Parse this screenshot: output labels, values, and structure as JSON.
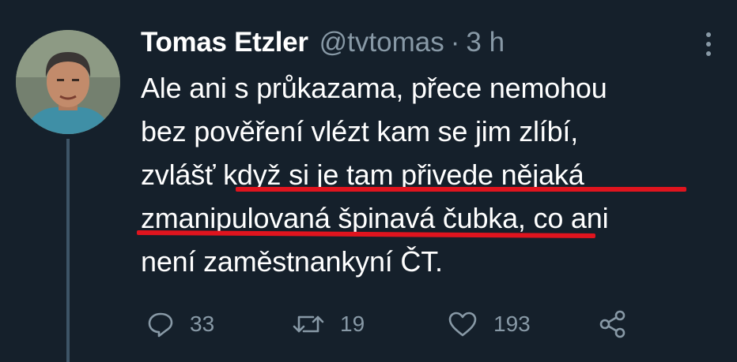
{
  "tweet": {
    "display_name": "Tomas Etzler",
    "handle": "@tvtomas",
    "separator": "·",
    "time": "3 h",
    "text_lines": [
      "Ale ani s průkazama, přece nemohou",
      "bez pověření vlézt kam se jim zlíbí,",
      "zvlášť když si je tam přivede nějaká",
      "zmanipulovaná špinavá čubka, co ani",
      "není zaměstnankyní ČT."
    ],
    "replies": "33",
    "retweets": "19",
    "likes": "193"
  },
  "colors": {
    "background": "#15202b",
    "secondary_text": "#8899a6",
    "underline_red": "#e0141e",
    "thread_line": "#3d5466"
  },
  "icons": {
    "more": "more-vertical-icon",
    "reply": "reply-icon",
    "retweet": "retweet-icon",
    "like": "heart-icon",
    "share": "share-icon"
  }
}
